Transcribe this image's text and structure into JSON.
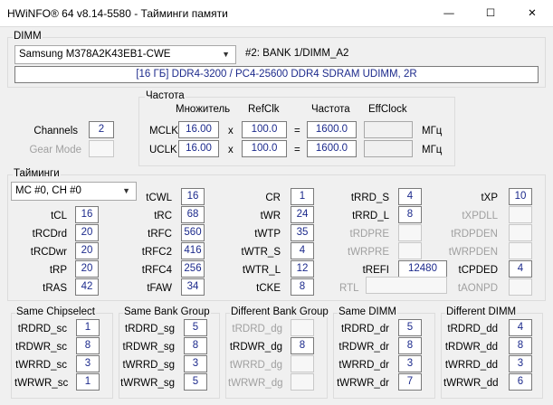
{
  "window": {
    "title": "HWiNFO® 64 v8.14-5580 - Тайминги памяти",
    "minimize": "—",
    "maximize": "☐",
    "close": "✕"
  },
  "dimm": {
    "group_label": "DIMM",
    "module_select": "Samsung M378A2K43EB1-CWE",
    "slot": "#2: BANK 1/DIMM_A2",
    "summary": "[16 ГБ] DDR4-3200 / PC4-25600 DDR4 SDRAM UDIMM, 2R"
  },
  "channels": {
    "label": "Channels",
    "value": "2",
    "gear_label": "Gear Mode",
    "gear_value": ""
  },
  "frequency": {
    "group_label": "Частота",
    "col_multiplier": "Множитель",
    "col_refclk": "RefClk",
    "col_freq": "Частота",
    "col_effclock": "EffClock",
    "times": "x",
    "equals": "=",
    "rows": [
      {
        "label": "MCLK",
        "multiplier": "16.00",
        "refclk": "100.0",
        "freq": "1600.0",
        "effclock": "",
        "unit": "МГц"
      },
      {
        "label": "UCLK",
        "multiplier": "16.00",
        "refclk": "100.0",
        "freq": "1600.0",
        "effclock": "",
        "unit": "МГц"
      }
    ]
  },
  "timings": {
    "group_label": "Тайминги",
    "channel_select": "MC #0, CH #0",
    "tCL": "16",
    "tRCDrd": "20",
    "tRCDwr": "20",
    "tRP": "20",
    "tRAS": "42",
    "tCWL": "16",
    "tRC": "68",
    "tRFC": "560",
    "tRFC2": "416",
    "tRFC4": "256",
    "tFAW": "34",
    "CR": "1",
    "tWR": "24",
    "tWTP": "35",
    "tWTR_S": "4",
    "tWTR_L": "12",
    "tCKE": "8",
    "tRRD_S": "4",
    "tRRD_L": "8",
    "tRDPRE": "",
    "tWRPRE": "",
    "tREFI": "12480",
    "RTL": "",
    "tXP": "10",
    "tXPDLL": "",
    "tRDPDEN": "",
    "tWRPDEN": "",
    "tCPDED": "4",
    "tAONPD": ""
  },
  "bottom": [
    {
      "title": "Same Chipselect",
      "rows": [
        {
          "label": "tRDRD_sc",
          "value": "1",
          "disabled": false
        },
        {
          "label": "tRDWR_sc",
          "value": "8",
          "disabled": false
        },
        {
          "label": "tWRRD_sc",
          "value": "3",
          "disabled": false
        },
        {
          "label": "tWRWR_sc",
          "value": "1",
          "disabled": false
        }
      ]
    },
    {
      "title": "Same Bank Group",
      "rows": [
        {
          "label": "tRDRD_sg",
          "value": "5",
          "disabled": false
        },
        {
          "label": "tRDWR_sg",
          "value": "8",
          "disabled": false
        },
        {
          "label": "tWRRD_sg",
          "value": "3",
          "disabled": false
        },
        {
          "label": "tWRWR_sg",
          "value": "5",
          "disabled": false
        }
      ]
    },
    {
      "title": "Different Bank Group",
      "rows": [
        {
          "label": "tRDRD_dg",
          "value": "",
          "disabled": true
        },
        {
          "label": "tRDWR_dg",
          "value": "8",
          "disabled": false
        },
        {
          "label": "tWRRD_dg",
          "value": "",
          "disabled": true
        },
        {
          "label": "tWRWR_dg",
          "value": "",
          "disabled": true
        }
      ]
    },
    {
      "title": "Same DIMM",
      "rows": [
        {
          "label": "tRDRD_dr",
          "value": "5",
          "disabled": false
        },
        {
          "label": "tRDWR_dr",
          "value": "8",
          "disabled": false
        },
        {
          "label": "tWRRD_dr",
          "value": "3",
          "disabled": false
        },
        {
          "label": "tWRWR_dr",
          "value": "7",
          "disabled": false
        }
      ]
    },
    {
      "title": "Different DIMM",
      "rows": [
        {
          "label": "tRDRD_dd",
          "value": "4",
          "disabled": false
        },
        {
          "label": "tRDWR_dd",
          "value": "8",
          "disabled": false
        },
        {
          "label": "tWRRD_dd",
          "value": "3",
          "disabled": false
        },
        {
          "label": "tWRWR_dd",
          "value": "6",
          "disabled": false
        }
      ]
    }
  ]
}
